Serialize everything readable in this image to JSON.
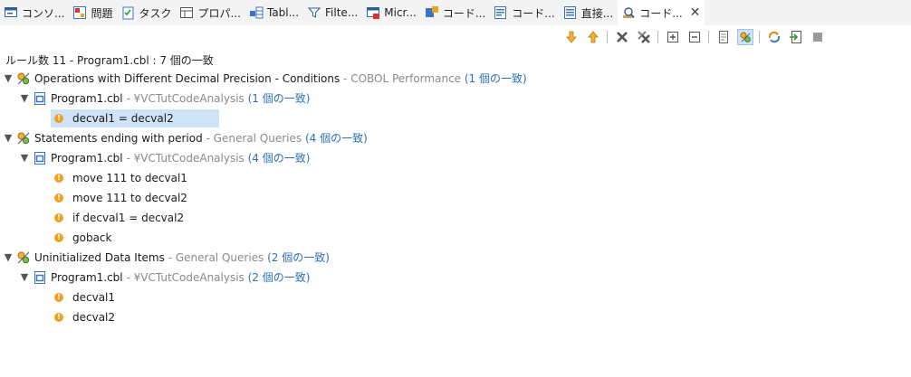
{
  "tabs": [
    {
      "label": "コンソ...",
      "icon": "console-icon",
      "active": false
    },
    {
      "label": "問題",
      "icon": "problems-icon",
      "active": false
    },
    {
      "label": "タスク",
      "icon": "tasks-icon",
      "active": false
    },
    {
      "label": "プロパ...",
      "icon": "properties-icon",
      "active": false
    },
    {
      "label": "Tabl...",
      "icon": "table-icon",
      "active": false
    },
    {
      "label": "Filte...",
      "icon": "filter-icon",
      "active": false
    },
    {
      "label": "Micr...",
      "icon": "micro-focus-icon",
      "active": false
    },
    {
      "label": "コード...",
      "icon": "code-icon",
      "active": false
    },
    {
      "label": "コード...",
      "icon": "code-list-icon",
      "active": false
    },
    {
      "label": "直接...",
      "icon": "direct-icon",
      "active": false
    },
    {
      "label": "コード...",
      "icon": "code-search-icon",
      "active": true
    }
  ],
  "toolbar": {
    "buttons": [
      "arrow-down-icon",
      "arrow-up-icon",
      "remove-icon",
      "remove-all-icon",
      "expand-all-icon",
      "collapse-all-icon",
      "show-details-icon",
      "show-rules-icon",
      "refresh-icon",
      "export-icon",
      "menu-icon"
    ]
  },
  "summary": "ルール数 11 - Program1.cbl : 7 個の一致",
  "tree": {
    "rule1": {
      "name": "Operations with Different Decimal Precision - Conditions",
      "sep": " - ",
      "category": "COBOL Performance",
      "count": " (1 個の一致)"
    },
    "file1": {
      "name": "Program1.cbl",
      "sep": " - ",
      "project": "¥VCTutCodeAnalysis",
      "count": " (1 個の一致)"
    },
    "match1_1": "decval1 = decval2",
    "rule2": {
      "name": "Statements ending with period",
      "sep": " - ",
      "category": "General Queries",
      "count": " (4 個の一致)"
    },
    "file2": {
      "name": "Program1.cbl",
      "sep": " - ",
      "project": "¥VCTutCodeAnalysis",
      "count": " (4 個の一致)"
    },
    "match2_1": "move 111 to decval1",
    "match2_2": "move 111 to decval2",
    "match2_3": "if decval1 = decval2",
    "match2_4": "goback",
    "rule3": {
      "name": "Uninitialized Data Items",
      "sep": " - ",
      "category": "General Queries",
      "count": " (2 個の一致)"
    },
    "file3": {
      "name": "Program1.cbl",
      "sep": " - ",
      "project": "¥VCTutCodeAnalysis",
      "count": " (2 個の一致)"
    },
    "match3_1": "decval1",
    "match3_2": "decval2"
  },
  "colors": {
    "accent": "#2e6fb7",
    "selection": "#cfe3f7",
    "warning": "#f0a020",
    "muted": "#8a8a8a"
  }
}
